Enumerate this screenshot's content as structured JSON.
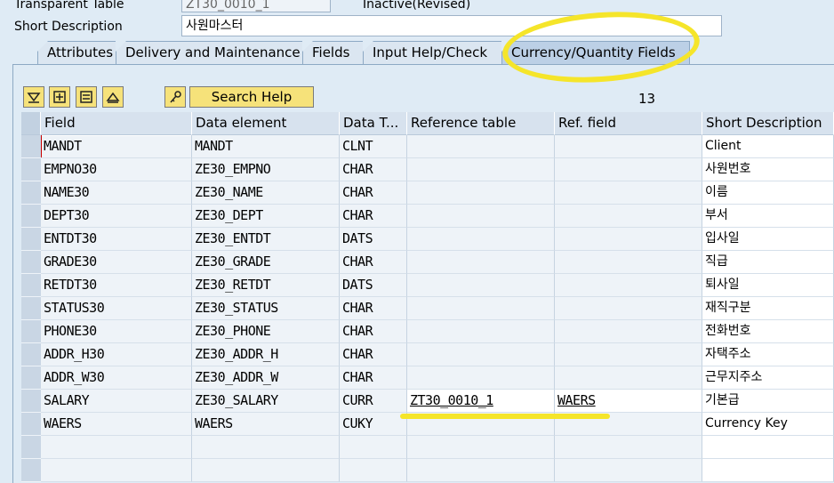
{
  "header": {
    "table_type_label": "Transparent Table",
    "table_name": "ZT30_0010_1",
    "status": "Inactive(Revised)",
    "short_desc_label": "Short Description",
    "short_desc_value": "사원마스터"
  },
  "tabs": [
    {
      "label": "Attributes"
    },
    {
      "label": "Delivery and Maintenance"
    },
    {
      "label": "Fields"
    },
    {
      "label": "Input Help/Check"
    },
    {
      "label": "Currency/Quantity Fields"
    }
  ],
  "toolbar": {
    "search_help_label": "Search Help",
    "count": "13"
  },
  "columns": [
    "Field",
    "Data element",
    "Data T...",
    "Reference table",
    "Ref. field",
    "Short Description"
  ],
  "rows": [
    {
      "field": "MANDT",
      "element": "MANDT",
      "type": "CLNT",
      "ref_table": "",
      "ref_field": "",
      "desc": "Client"
    },
    {
      "field": "EMPNO30",
      "element": "ZE30_EMPNO",
      "type": "CHAR",
      "ref_table": "",
      "ref_field": "",
      "desc": "사원번호"
    },
    {
      "field": "NAME30",
      "element": "ZE30_NAME",
      "type": "CHAR",
      "ref_table": "",
      "ref_field": "",
      "desc": "이름"
    },
    {
      "field": "DEPT30",
      "element": "ZE30_DEPT",
      "type": "CHAR",
      "ref_table": "",
      "ref_field": "",
      "desc": "부서"
    },
    {
      "field": "ENTDT30",
      "element": "ZE30_ENTDT",
      "type": "DATS",
      "ref_table": "",
      "ref_field": "",
      "desc": "입사일"
    },
    {
      "field": "GRADE30",
      "element": "ZE30_GRADE",
      "type": "CHAR",
      "ref_table": "",
      "ref_field": "",
      "desc": "직급"
    },
    {
      "field": "RETDT30",
      "element": "ZE30_RETDT",
      "type": "DATS",
      "ref_table": "",
      "ref_field": "",
      "desc": "퇴사일"
    },
    {
      "field": "STATUS30",
      "element": "ZE30_STATUS",
      "type": "CHAR",
      "ref_table": "",
      "ref_field": "",
      "desc": "재직구분"
    },
    {
      "field": "PHONE30",
      "element": "ZE30_PHONE",
      "type": "CHAR",
      "ref_table": "",
      "ref_field": "",
      "desc": "전화번호"
    },
    {
      "field": "ADDR_H30",
      "element": "ZE30_ADDR_H",
      "type": "CHAR",
      "ref_table": "",
      "ref_field": "",
      "desc": "자택주소"
    },
    {
      "field": "ADDR_W30",
      "element": "ZE30_ADDR_W",
      "type": "CHAR",
      "ref_table": "",
      "ref_field": "",
      "desc": "근무지주소"
    },
    {
      "field": "SALARY",
      "element": "ZE30_SALARY",
      "type": "CURR",
      "ref_table": "ZT30_0010_1",
      "ref_field": "WAERS",
      "desc": "기본급"
    },
    {
      "field": "WAERS",
      "element": "WAERS",
      "type": "CUKY",
      "ref_table": "",
      "ref_field": "",
      "desc": "Currency Key"
    }
  ],
  "colors": {
    "background": "#dfebf5",
    "button_yellow": "#f6e27a",
    "highlight_marker": "#f5e52a"
  }
}
